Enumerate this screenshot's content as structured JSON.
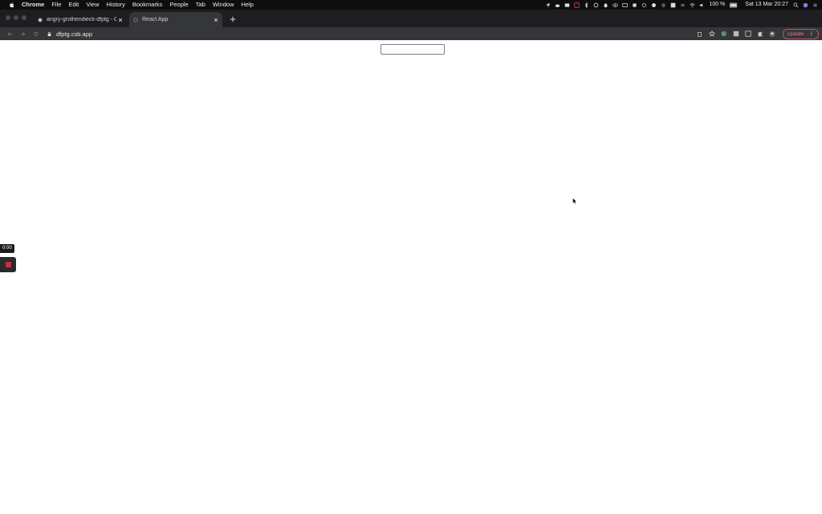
{
  "menubar": {
    "app_name": "Chrome",
    "items": [
      "File",
      "Edit",
      "View",
      "History",
      "Bookmarks",
      "People",
      "Tab",
      "Window",
      "Help"
    ],
    "battery": "100 %",
    "datetime": "Sat 13 Mar  20:27"
  },
  "tabs": [
    {
      "title": "angry-grothendieck-dfptg - C..."
    },
    {
      "title": "React App"
    }
  ],
  "toolbar": {
    "url": "dfptg.csb.app",
    "update_label": "Update"
  },
  "overlay": {
    "timer": "0:00"
  },
  "colors": {
    "menubar_bg": "#0e0e0e",
    "tabstrip_bg": "#1e1e20",
    "toolbar_bg": "#35363a",
    "update_accent": "#c4525a",
    "record_red": "#c9303a"
  },
  "icons": [
    "apple-icon",
    "location-icon",
    "cloud-icon",
    "wifi-icon",
    "volume-icon",
    "battery-icon",
    "search-icon",
    "siri-icon",
    "control-center-icon",
    "lock-icon",
    "star-icon",
    "extensions-icon",
    "back-icon",
    "forward-icon",
    "reload-icon"
  ]
}
